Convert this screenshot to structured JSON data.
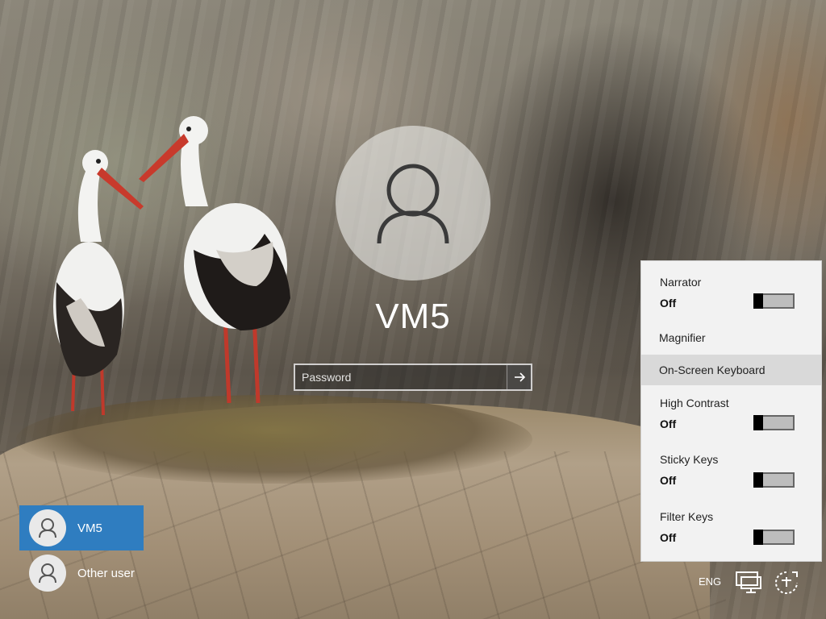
{
  "login": {
    "username": "VM5",
    "password_placeholder": "Password"
  },
  "users": [
    {
      "name": "VM5",
      "selected": true
    },
    {
      "name": "Other user",
      "selected": false
    }
  ],
  "ease_of_access": {
    "items": [
      {
        "label": "Narrator",
        "state": "Off",
        "toggle_on": false
      },
      {
        "label": "Magnifier"
      },
      {
        "label": "On-Screen Keyboard",
        "highlighted": true
      },
      {
        "label": "High Contrast",
        "state": "Off",
        "toggle_on": false
      },
      {
        "label": "Sticky Keys",
        "state": "Off",
        "toggle_on": false
      },
      {
        "label": "Filter Keys",
        "state": "Off",
        "toggle_on": false
      }
    ]
  },
  "system_tray": {
    "language": "ENG",
    "icons": [
      "network-icon",
      "ease-of-access-icon"
    ]
  },
  "colors": {
    "accent": "#2f7dc0",
    "panel_bg": "#f2f2f2",
    "panel_hover": "#d9d9d9"
  }
}
